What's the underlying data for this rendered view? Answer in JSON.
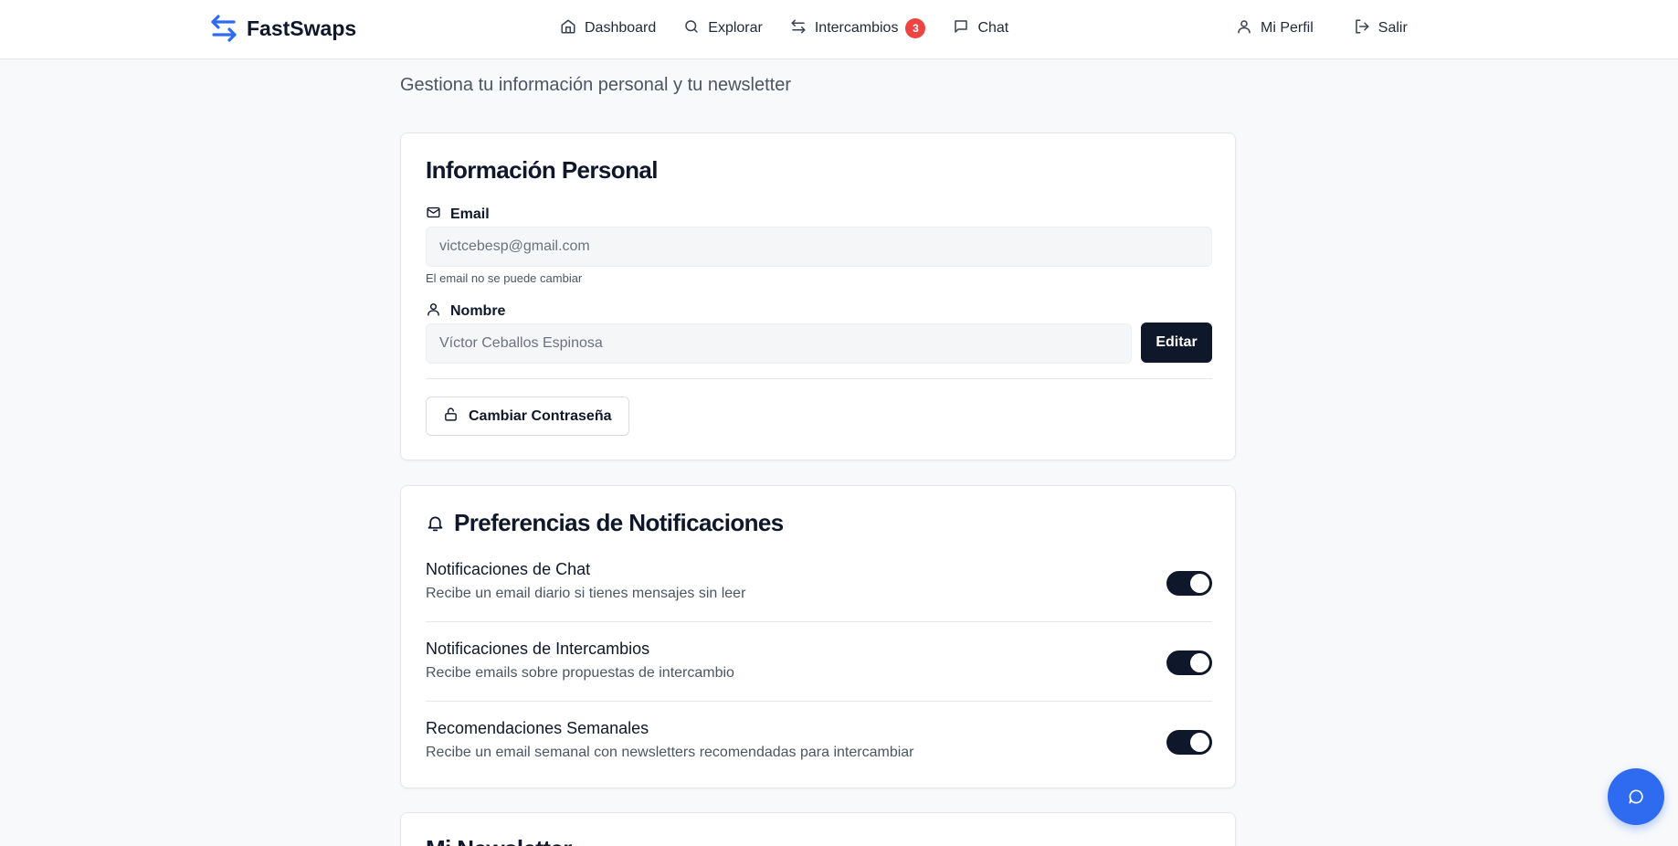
{
  "brand": {
    "name": "FastSwaps"
  },
  "nav": {
    "dashboard": "Dashboard",
    "explorar": "Explorar",
    "intercambios": "Intercambios",
    "intercambios_badge": "3",
    "chat": "Chat",
    "perfil": "Mi Perfil",
    "salir": "Salir"
  },
  "page": {
    "subtitle": "Gestiona tu información personal y tu newsletter"
  },
  "personal": {
    "title": "Información Personal",
    "email_label": "Email",
    "email_value": "victcebesp@gmail.com",
    "email_hint": "El email no se puede cambiar",
    "name_label": "Nombre",
    "name_value": "Víctor Ceballos Espinosa",
    "edit_button": "Editar",
    "change_password_button": "Cambiar Contraseña"
  },
  "notifications": {
    "title": "Preferencias de Notificaciones",
    "items": [
      {
        "title": "Notificaciones de Chat",
        "description": "Recibe un email diario si tienes mensajes sin leer",
        "enabled": true
      },
      {
        "title": "Notificaciones de Intercambios",
        "description": "Recibe emails sobre propuestas de intercambio",
        "enabled": true
      },
      {
        "title": "Recomendaciones Semanales",
        "description": "Recibe un email semanal con newsletters recomendadas para intercambiar",
        "enabled": true
      }
    ]
  },
  "newsletter": {
    "title": "Mi Newsletter"
  },
  "colors": {
    "brand_blue": "#2f6bf0",
    "dark": "#0f172a",
    "badge_red": "#ef4444"
  }
}
